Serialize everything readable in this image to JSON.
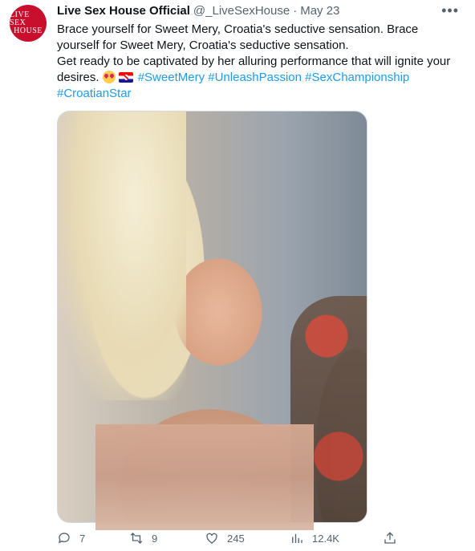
{
  "tweet": {
    "avatar_text": [
      "LIVE SEX",
      "HOUSE"
    ],
    "display_name": "Live Sex House Official",
    "handle": "@_LiveSexHouse",
    "separator": "·",
    "date": "May 23",
    "more_icon": "more-horizontal-icon",
    "text_line1": "Brace yourself for Sweet Mery, Croatia's seductive sensation. Brace yourself for Sweet Mery, Croatia's seductive sensation.",
    "text_line2": "Get ready to be captivated by her alluring performance that will ignite your desires.",
    "emoji_1": "smiling-face-with-heart-eyes",
    "emoji_2": "croatia-flag",
    "hashtags": [
      "#SweetMery",
      "#UnleashPassion",
      "#SexChampionship",
      "#CroatianStar"
    ]
  },
  "actions": {
    "reply_count": "7",
    "retweet_count": "9",
    "like_count": "245",
    "views_count": "12.4K"
  },
  "colors": {
    "link": "#1d9bf0",
    "muted": "#536471",
    "avatar_bg": "#c8102e"
  }
}
